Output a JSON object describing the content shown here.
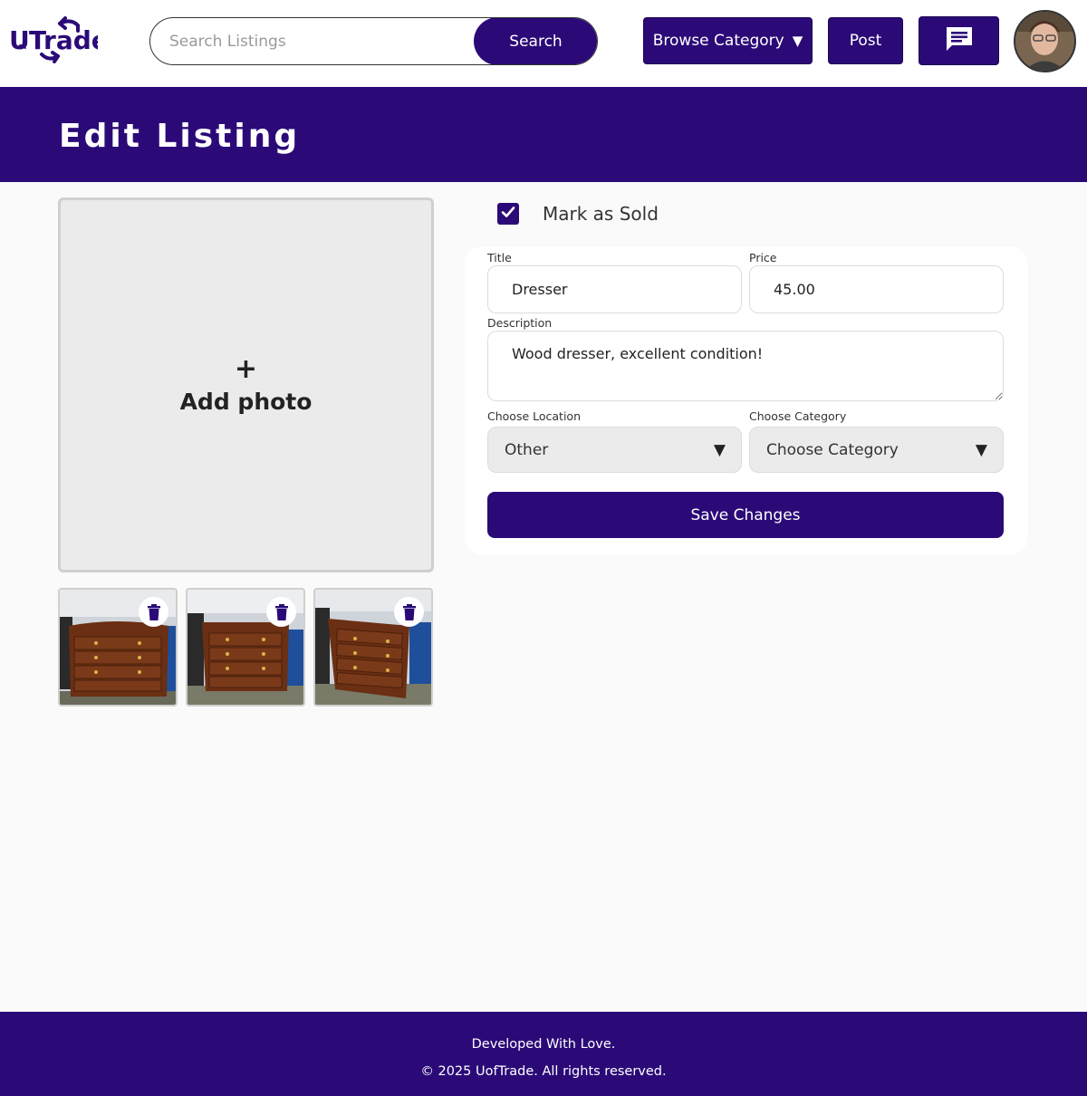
{
  "header": {
    "logo_text": "UofTrade",
    "search": {
      "placeholder": "Search Listings",
      "value": "",
      "button_label": "Search"
    },
    "browse_label": "Browse Category",
    "post_label": "Post"
  },
  "banner": {
    "title": "Edit Listing"
  },
  "photos": {
    "add_label": "Add photo",
    "thumbnails": [
      {
        "alt": "dresser photo 1"
      },
      {
        "alt": "dresser photo 2"
      },
      {
        "alt": "dresser photo 3"
      }
    ]
  },
  "form": {
    "sold": {
      "label": "Mark as Sold",
      "checked": true
    },
    "title": {
      "label": "Title",
      "value": "Dresser"
    },
    "price": {
      "label": "Price",
      "value": "45.00"
    },
    "description": {
      "label": "Description",
      "value": "Wood dresser, excellent condition!"
    },
    "location": {
      "label": "Choose Location",
      "selected": "Other"
    },
    "category": {
      "label": "Choose Category",
      "selected": "Choose Category"
    },
    "save_label": "Save Changes"
  },
  "footer": {
    "line1": "Developed With Love.",
    "line2": "© 2025 UofTrade. All rights reserved."
  },
  "colors": {
    "brand": "#2b0a78",
    "background": "#fafafa",
    "drop_zone": "#ebebeb"
  }
}
